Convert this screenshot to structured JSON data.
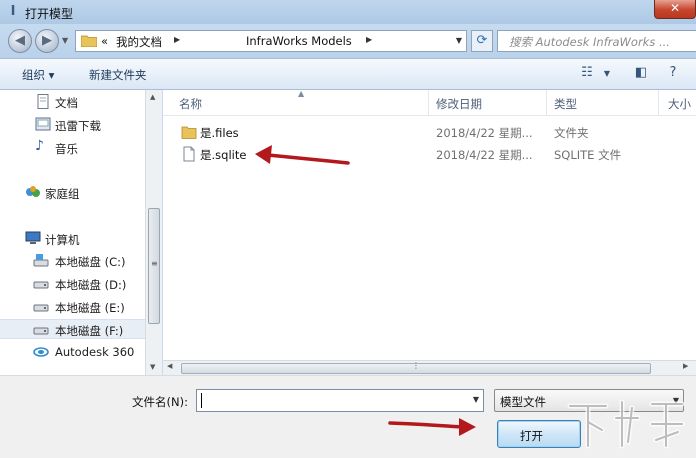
{
  "window": {
    "title": "打开模型",
    "app_icon": "infraworks-icon",
    "close_label": "✕"
  },
  "nav": {
    "back_icon": "back-arrow-icon",
    "forward_icon": "forward-arrow-icon",
    "address_prefix": "«",
    "address_segments": [
      "我的文档",
      "InfraWorks Models"
    ],
    "refresh_icon": "refresh-icon",
    "search_placeholder": "搜索 Autodesk InfraWorks ..."
  },
  "toolbar": {
    "organize_label": "组织 ▾",
    "new_folder_label": "新建文件夹"
  },
  "sidebar": {
    "items": [
      {
        "label": "文档",
        "icon": "document-icon"
      },
      {
        "label": "迅雷下载",
        "icon": "download-icon"
      },
      {
        "label": "音乐",
        "icon": "music-icon"
      },
      {
        "label": "家庭组",
        "icon": "homegroup-icon"
      },
      {
        "label": "计算机",
        "icon": "computer-icon"
      },
      {
        "label": "本地磁盘 (C:)",
        "icon": "system-drive-icon"
      },
      {
        "label": "本地磁盘 (D:)",
        "icon": "drive-icon"
      },
      {
        "label": "本地磁盘 (E:)",
        "icon": "drive-icon"
      },
      {
        "label": "本地磁盘 (F:)",
        "icon": "drive-icon",
        "selected": true
      },
      {
        "label": "Autodesk 360",
        "icon": "cloud-icon"
      }
    ]
  },
  "files": {
    "columns": [
      "名称",
      "修改日期",
      "类型",
      "大小"
    ],
    "rows": [
      {
        "name": "是.files",
        "date": "2018/4/22 星期...",
        "type": "文件夹",
        "icon": "folder-icon"
      },
      {
        "name": "是.sqlite",
        "date": "2018/4/22 星期...",
        "type": "SQLITE 文件",
        "icon": "file-icon"
      }
    ]
  },
  "footer": {
    "filename_label": "文件名(N):",
    "filename_value": "",
    "filetype_value": "模型文件",
    "open_label": "打开"
  },
  "colors": {
    "annotation_arrow": "#b3191c",
    "accent": "#3c7fb1"
  }
}
